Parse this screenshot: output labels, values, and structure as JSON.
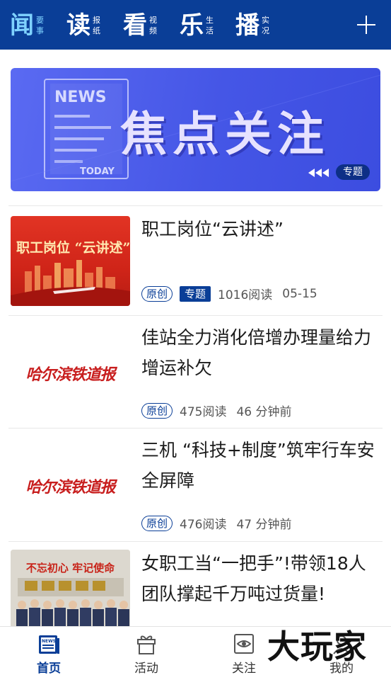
{
  "nav": {
    "tabs": [
      {
        "char": "闻",
        "sub1": "要",
        "sub2": "事"
      },
      {
        "char": "读",
        "sub1": "报",
        "sub2": "纸"
      },
      {
        "char": "看",
        "sub1": "视",
        "sub2": "频"
      },
      {
        "char": "乐",
        "sub1": "生",
        "sub2": "活"
      },
      {
        "char": "播",
        "sub1": "实",
        "sub2": "况"
      }
    ],
    "add_icon": "plus-icon"
  },
  "banner": {
    "news_label": "NEWS",
    "today_label": "TODAY",
    "title": "焦点关注",
    "tag": "专题"
  },
  "articles": [
    {
      "title": "职工岗位“云讲述”",
      "thumb_text": "职工岗位 “云讲述”",
      "badge_original": "原创",
      "badge_topic": "专题",
      "reads": "1016阅读",
      "time": "05-15"
    },
    {
      "title": "佳站全力消化倍增办理量给力增运补欠",
      "thumb_text": "哈尔滨铁道报",
      "badge_original": "原创",
      "reads": "475阅读",
      "time": "46 分钟前"
    },
    {
      "title": "三机 “科技+制度”筑牢行车安全屏障",
      "thumb_text": "哈尔滨铁道报",
      "badge_original": "原创",
      "reads": "476阅读",
      "time": "47 分钟前"
    },
    {
      "title": "女职工当“一把手”!带领18人团队撑起千万吨过货量!",
      "thumb_text": "不忘初心 牢记使命"
    }
  ],
  "tabbar": {
    "items": [
      {
        "label": "首页",
        "icon": "news-icon"
      },
      {
        "label": "活动",
        "icon": "gift-icon"
      },
      {
        "label": "关注",
        "icon": "eye-icon"
      },
      {
        "label": "我的",
        "icon": "person-icon"
      }
    ]
  },
  "watermark": "大玩家",
  "colors": {
    "brand": "#0a3e97",
    "active_nav": "#7fd2ff",
    "banner": "#4556e6"
  }
}
